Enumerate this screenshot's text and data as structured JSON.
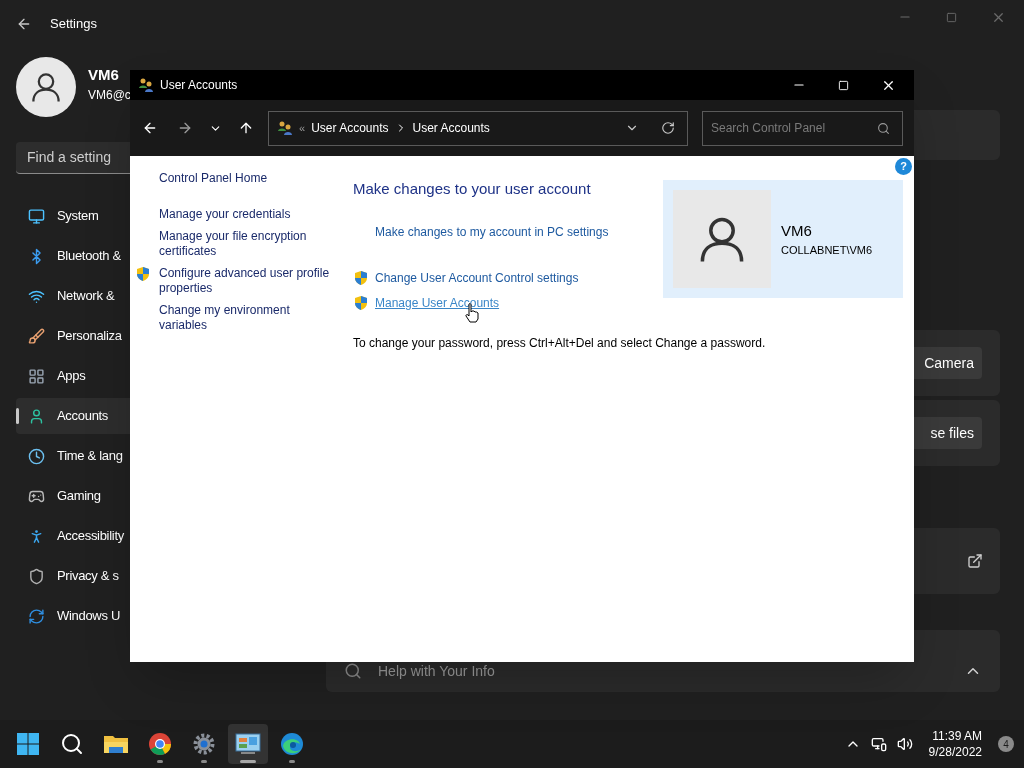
{
  "settings": {
    "title": "Settings",
    "user": {
      "name": "VM6",
      "email": "VM6@c"
    },
    "search": {
      "placeholder": "Find a setting"
    },
    "nav": [
      {
        "kind": "system",
        "label": "System",
        "selected": false
      },
      {
        "kind": "bluetooth",
        "label": "Bluetooth &",
        "selected": false
      },
      {
        "kind": "network",
        "label": "Network &",
        "selected": false
      },
      {
        "kind": "personalization",
        "label": "Personaliza",
        "selected": false
      },
      {
        "kind": "apps",
        "label": "Apps",
        "selected": false
      },
      {
        "kind": "accounts",
        "label": "Accounts",
        "selected": true
      },
      {
        "kind": "time",
        "label": "Time & lang",
        "selected": false
      },
      {
        "kind": "gaming",
        "label": "Gaming",
        "selected": false
      },
      {
        "kind": "accessibility",
        "label": "Accessibility",
        "selected": false
      },
      {
        "kind": "privacy",
        "label": "Privacy & s",
        "selected": false
      },
      {
        "kind": "update",
        "label": "Windows U",
        "selected": false
      }
    ],
    "cards": [
      {
        "kind": "blank"
      },
      {
        "kind": "button",
        "button": "Camera"
      },
      {
        "kind": "button",
        "button": "se files"
      },
      {
        "kind": "link"
      },
      {
        "kind": "expander",
        "label": "Help with Your Info"
      }
    ]
  },
  "dialog": {
    "title": "User Accounts",
    "breadcrumb": {
      "overflow": "«",
      "items": [
        "User Accounts",
        "User Accounts"
      ]
    },
    "search": {
      "placeholder": "Search Control Panel"
    },
    "help": "?",
    "side_links": [
      {
        "label": "Control Panel Home",
        "shield": false
      },
      {
        "label": "Manage your credentials",
        "shield": false
      },
      {
        "label": "Manage your file encryption certificates",
        "shield": false
      },
      {
        "label": "Configure advanced user profile properties",
        "shield": true
      },
      {
        "label": "Change my environment variables",
        "shield": false
      }
    ],
    "heading": "Make changes to your user account",
    "tasks": [
      {
        "label": "Make changes to my account in PC settings",
        "shield": false,
        "hovered": false
      },
      {
        "label": "Change User Account Control settings",
        "shield": true,
        "hovered": false
      },
      {
        "label": "Manage User Accounts",
        "shield": true,
        "hovered": true
      }
    ],
    "account": {
      "name": "VM6",
      "domain": "COLLABNET\\VM6"
    },
    "note": "To change your password, press Ctrl+Alt+Del and select Change a password."
  },
  "taskbar": {
    "apps": [
      {
        "kind": "start",
        "running": false,
        "selected": false
      },
      {
        "kind": "search",
        "running": false,
        "selected": false
      },
      {
        "kind": "folder",
        "running": false,
        "selected": false
      },
      {
        "kind": "chrome",
        "running": true,
        "selected": false
      },
      {
        "kind": "settings",
        "running": true,
        "selected": false
      },
      {
        "kind": "controlpanel",
        "running": true,
        "selected": true
      },
      {
        "kind": "edge",
        "running": true,
        "selected": false
      }
    ],
    "time": "11:39 AM",
    "date": "9/28/2022",
    "notifications": "4"
  }
}
